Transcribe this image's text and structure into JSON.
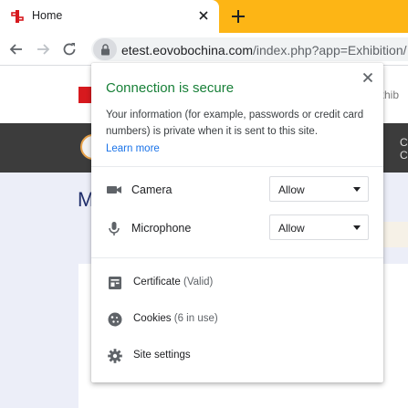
{
  "tab": {
    "title": "Home",
    "favicon": "exhibition-logo-icon",
    "accent": "#fdb515"
  },
  "toolbar": {
    "back": "back-arrow-icon",
    "forward": "forward-arrow-icon",
    "reload": "reload-icon",
    "url_host": "etest.eovobochina.com",
    "url_path": "/index.php?app=Exhibition/"
  },
  "page": {
    "exhib_text": "xhib",
    "right_text_1": "C",
    "right_text_2": "C",
    "big_letter": "M"
  },
  "popup": {
    "title": "Connection is secure",
    "title_color": "#188038",
    "description": "Your information (for example, passwords or credit card numbers) is private when it is sent to this site.",
    "learn_more": "Learn more",
    "permissions": [
      {
        "label": "Camera",
        "icon": "camera-icon",
        "value": "Allow"
      },
      {
        "label": "Microphone",
        "icon": "microphone-icon",
        "value": "Allow"
      }
    ],
    "links": [
      {
        "label": "Certificate",
        "sub": "(Valid)",
        "icon": "certificate-icon"
      },
      {
        "label": "Cookies",
        "sub": "(6 in use)",
        "icon": "cookie-icon"
      },
      {
        "label": "Site settings",
        "sub": "",
        "icon": "settings-gear-icon"
      }
    ]
  }
}
